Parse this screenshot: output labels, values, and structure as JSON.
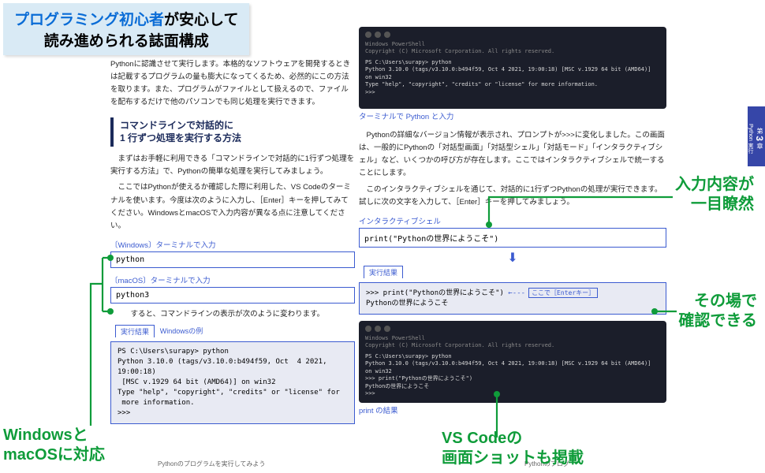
{
  "banner": {
    "line1_highlight": "プログラミング初心者",
    "line1_rest": "が安心して",
    "line2": "読み進められる誌面構成"
  },
  "left": {
    "para1": "Pythonに認識させて実行します。本格的なソフトウェアを開発するときは記載するプログラムの量も膨大になってくるため、必然的にこの方法を取ります。また、プログラムがファイルとして扱えるので、ファイルを配布するだけで他のパソコンでも同じ処理を実行できます。",
    "heading_l1": "コマンドラインで対話的に",
    "heading_l2": "1 行ずつ処理を実行する方法",
    "para2": "　まずはお手軽に利用できる「コマンドラインで対話的に1行ずつ処理を実行する方法」で、Pythonの簡単な処理を実行してみましょう。",
    "para3": "　ここではPythonが使えるか確認した際に利用した、VS Codeのターミナルを使います。今度は次のように入力し、［Enter］キーを押してみてください。WindowsとmacOSで入力内容が異なる点に注意してください。",
    "win_label": "〔Windows〕ターミナルで入力",
    "win_code": "python",
    "mac_label": "〔macOS〕ターミナルで入力",
    "mac_code": "python3",
    "para4": "　すると、コマンドラインの表示が次のように変わります。",
    "result_tab": "実行結果",
    "result_sub": "Windowsの例",
    "result_body": "PS C:\\Users\\surapy> python\nPython 3.10.0 (tags/v3.10.0:b494f59, Oct  4 2021, 19:00:18)\n [MSC v.1929 64 bit (AMD64)] on win32\nType \"help\", \"copyright\", \"credits\" or \"license\" for\n more information.\n>>>",
    "footer": "Pythonのプログラムを実行してみよう"
  },
  "right": {
    "vscode1": "PS C:\\Users\\surapy> python\nPython 3.10.0 (tags/v3.10.0:b494f59, Oct 4 2021, 19:00:18) [MSC v.1929 64 bit (AMD64)] on win32\nType \"help\", \"copyright\", \"credits\" or \"license\" for more information.\n>>>",
    "cap1": "ターミナルで Python と入力",
    "para1": "　Pythonの詳細なバージョン情報が表示され、プロンプトが>>>に変化しました。この画面は、一般的にPythonの「対話型画面」「対話型シェル」「対話モード」「インタラクティブシェル」など、いくつかの呼び方が存在します。ここではインタラクティブシェルで統一することにします。",
    "para2": "　このインタラクティブシェルを通じて、対話的に1行ずつPythonの処理が実行できます。試しに次の文字を入力して、［Enter］キーを押してみましょう。",
    "shell_label": "インタラクティブシェル",
    "shell_code": "print(\"Pythonの世界にようこそ\")",
    "result_tab": "実行結果",
    "result_body_line1": ">>> print(\"Pythonの世界にようこそ\")",
    "result_keynote": "ここで［Enterキー］",
    "result_body_line2": "Pythonの世界にようこそ",
    "vscode2": "PS C:\\Users\\surapy> python\nPython 3.10.0 (tags/v3.10.0:b494f59, Oct 4 2021, 19:00:18) [MSC v.1929 64 bit (AMD64)] on win32\n>>> print(\"Pythonの世界にようこそ\")\nPythonの世界にようこそ\n>>>",
    "cap2": "print の結果",
    "footer": "Pythonのプログ"
  },
  "sidetab": {
    "chapter": "第",
    "num": "3",
    "unit": "章",
    "text": "Python 実行"
  },
  "annot": {
    "a1_l1": "入力内容が",
    "a1_l2": "一目瞭然",
    "a2_l1": "その場で",
    "a2_l2": "確認できる",
    "a3_l1": "VS Codeの",
    "a3_l2": "画面ショットも掲載",
    "a4_l1": "Windowsと",
    "a4_l2": "macOSに対応"
  }
}
